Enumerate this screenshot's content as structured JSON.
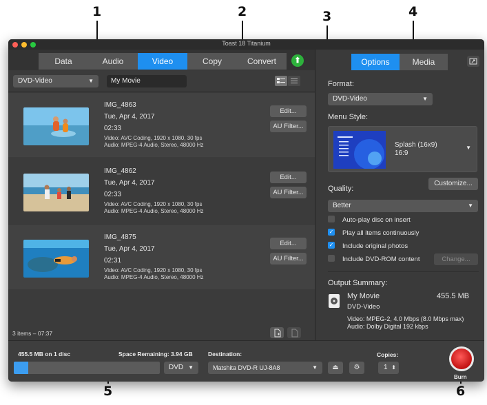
{
  "callouts": [
    "1",
    "2",
    "3",
    "4",
    "5",
    "6"
  ],
  "window": {
    "title": "Toast 18 Titanium"
  },
  "tabs": [
    {
      "label": "Data"
    },
    {
      "label": "Audio"
    },
    {
      "label": "Video"
    },
    {
      "label": "Copy"
    },
    {
      "label": "Convert"
    }
  ],
  "active_tab": "Video",
  "toolbar": {
    "format_select": "DVD-Video",
    "title_field": "My Movie"
  },
  "items": [
    {
      "name": "IMG_4863",
      "date": "Tue, Apr 4, 2017",
      "duration": "02:33",
      "video": "Video: AVC Coding, 1920 x 1080, 30 fps",
      "audio": "Audio: MPEG-4 Audio, Stereo, 48000 Hz",
      "edit": "Edit...",
      "filter": "AU Filter..."
    },
    {
      "name": "IMG_4862",
      "date": "Tue, Apr 4, 2017",
      "duration": "02:33",
      "video": "Video: AVC Coding, 1920 x 1080, 30 fps",
      "audio": "Audio: MPEG-4 Audio, Stereo, 48000 Hz",
      "edit": "Edit...",
      "filter": "AU Filter..."
    },
    {
      "name": "IMG_4875",
      "date": "Tue, Apr 4, 2017",
      "duration": "02:31",
      "video": "Video: AVC Coding, 1920 x 1080, 30 fps",
      "audio": "Audio: MPEG-4 Audio, Stereo, 48000 Hz",
      "edit": "Edit...",
      "filter": "AU Filter..."
    }
  ],
  "status": {
    "summary": "3 items – 07:37"
  },
  "right_panel": {
    "tabs": [
      {
        "label": "Options"
      },
      {
        "label": "Media"
      }
    ],
    "active_tab": "Options",
    "format_label": "Format:",
    "format_value": "DVD-Video",
    "menu_style_label": "Menu Style:",
    "menu_style_name": "Splash (16x9)",
    "menu_style_ratio": "16:9",
    "customize": "Customize...",
    "quality_label": "Quality:",
    "quality_value": "Better",
    "options": [
      {
        "label": "Auto-play disc on insert",
        "checked": false
      },
      {
        "label": "Play all items continuously",
        "checked": true
      },
      {
        "label": "Include original photos",
        "checked": true
      },
      {
        "label": "Include DVD-ROM content",
        "checked": false
      }
    ],
    "change": "Change...",
    "output_summary_label": "Output Summary:",
    "output_title": "My Movie",
    "output_size": "455.5 MB",
    "output_format": "DVD-Video",
    "output_video": "Video: MPEG-2, 4.0 Mbps (8.0 Mbps max)",
    "output_audio": "Audio: Dolby Digital 192 kbps"
  },
  "bottom": {
    "disc_usage": "455.5 MB on 1 disc",
    "space_remaining": "Space Remaining: 3.94 GB",
    "disc_type": "DVD",
    "capacity_fraction": 0.1,
    "destination_label": "Destination:",
    "destination_value": "Matshita DVD-R   UJ-8A8",
    "copies_label": "Copies:",
    "copies_value": "1",
    "burn_label": "Burn"
  },
  "colors": {
    "accent": "#1e8ff0",
    "burn": "#d81c1c",
    "upload": "#2db13c"
  }
}
